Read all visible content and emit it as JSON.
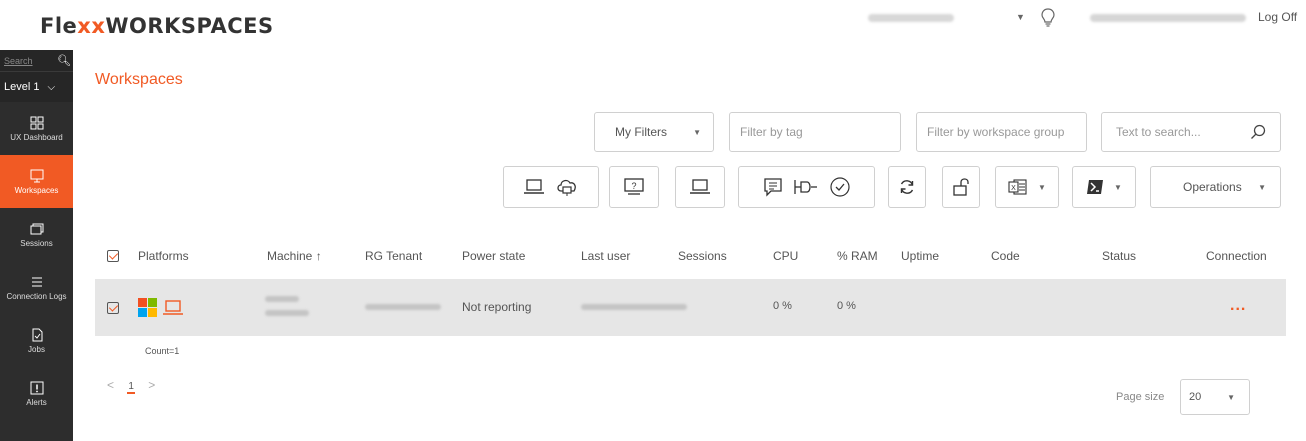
{
  "header": {
    "logo_flexx_part1": "Fle",
    "logo_xx": "xx",
    "logo_rest": "WORKSPACES",
    "logoff": "Log Off"
  },
  "sidebar": {
    "search_placeholder": "Search",
    "level": "Level 1",
    "items": [
      {
        "label": "UX Dashboard",
        "icon": "dashboard-icon"
      },
      {
        "label": "Workspaces",
        "icon": "monitor-icon",
        "active": true
      },
      {
        "label": "Sessions",
        "icon": "sessions-icon"
      },
      {
        "label": "Connection Logs",
        "icon": "list-icon"
      },
      {
        "label": "Jobs",
        "icon": "jobs-icon"
      },
      {
        "label": "Alerts",
        "icon": "alert-icon"
      }
    ]
  },
  "page": {
    "title": "Workspaces"
  },
  "filters": {
    "my_filters": "My Filters",
    "tag_placeholder": "Filter by tag",
    "group_placeholder": "Filter by workspace group",
    "search_placeholder": "Text to search..."
  },
  "toolbar": {
    "operations": "Operations"
  },
  "table": {
    "columns": [
      "Platforms",
      "Machine ↑",
      "RG Tenant",
      "Power state",
      "Last user",
      "Sessions",
      "CPU",
      "% RAM",
      "Uptime",
      "Code",
      "Status",
      "Connection"
    ],
    "rows": [
      {
        "power_state": "Not reporting",
        "cpu": "0 %",
        "ram": "0 %",
        "connection": "..."
      }
    ],
    "count": "Count=1"
  },
  "pagination": {
    "prev": "<",
    "page": "1",
    "next": ">",
    "page_size_label": "Page size",
    "page_size": "20"
  },
  "colors": {
    "accent": "#f15a24",
    "sidebar_bg": "#2d2d2d"
  }
}
